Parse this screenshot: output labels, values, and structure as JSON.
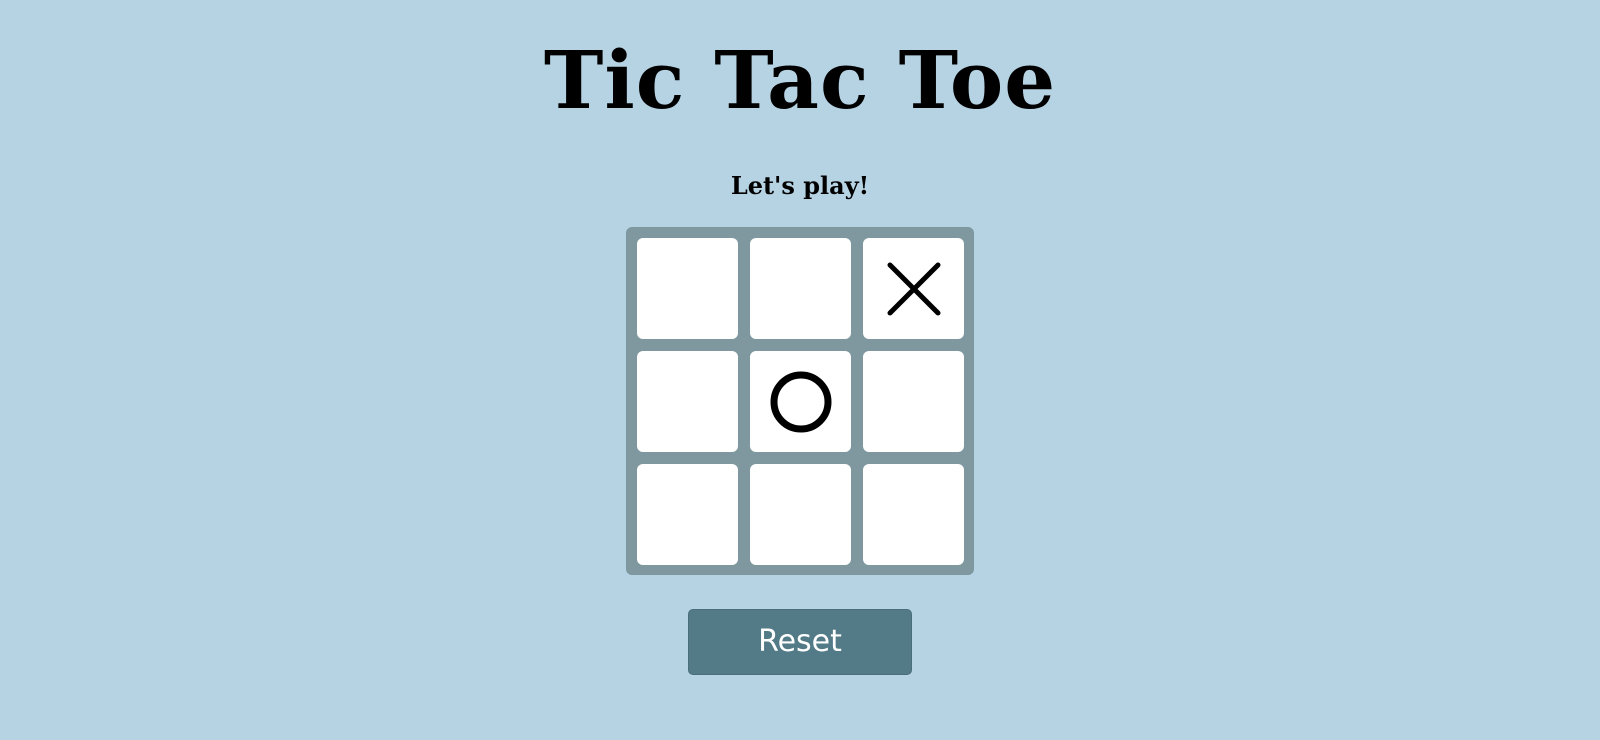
{
  "header": {
    "title": "Tic Tac Toe"
  },
  "status": {
    "message": "Let's play!"
  },
  "board": {
    "cells": [
      "",
      "",
      "X",
      "",
      "O",
      "",
      "",
      "",
      ""
    ]
  },
  "controls": {
    "reset_label": "Reset"
  },
  "colors": {
    "background": "#b6d3e4",
    "board": "#7f979f",
    "cell": "#ffffff",
    "button": "#527a87",
    "mark": "#000000"
  }
}
